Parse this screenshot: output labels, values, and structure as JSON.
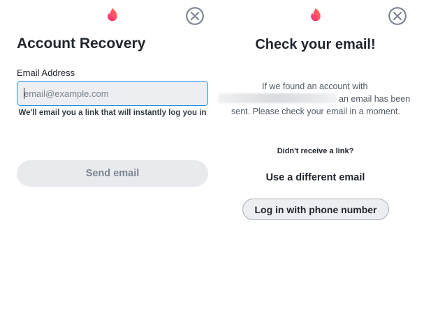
{
  "left_panel": {
    "logo_icon": "flame-icon",
    "close_icon": "close-circle-icon",
    "title": "Account Recovery",
    "email_label": "Email Address",
    "email_placeholder": "email@example.com",
    "email_value": "",
    "helper_text": "We'll email you a link that will instantly log you in",
    "send_button_label": "Send email"
  },
  "right_panel": {
    "logo_icon": "flame-icon",
    "close_icon": "close-circle-icon",
    "title": "Check your email!",
    "message_line1": "If we found an account with",
    "message_line2_suffix": "an email has been",
    "message_line3": "sent. Please check your email in a moment.",
    "didnt_receive": "Didn't receive a link?",
    "different_email_label": "Use a different email",
    "phone_button_label": "Log in with phone number"
  },
  "colors": {
    "brand_gradient_start": "#fd267a",
    "brand_gradient_end": "#ff7854",
    "input_focus_border": "#1f8fe8",
    "text_primary": "#21262e",
    "text_secondary": "#505965",
    "disabled_button_bg": "#e9eaee",
    "disabled_button_text": "#7c8591",
    "close_icon": "#7c8591"
  }
}
